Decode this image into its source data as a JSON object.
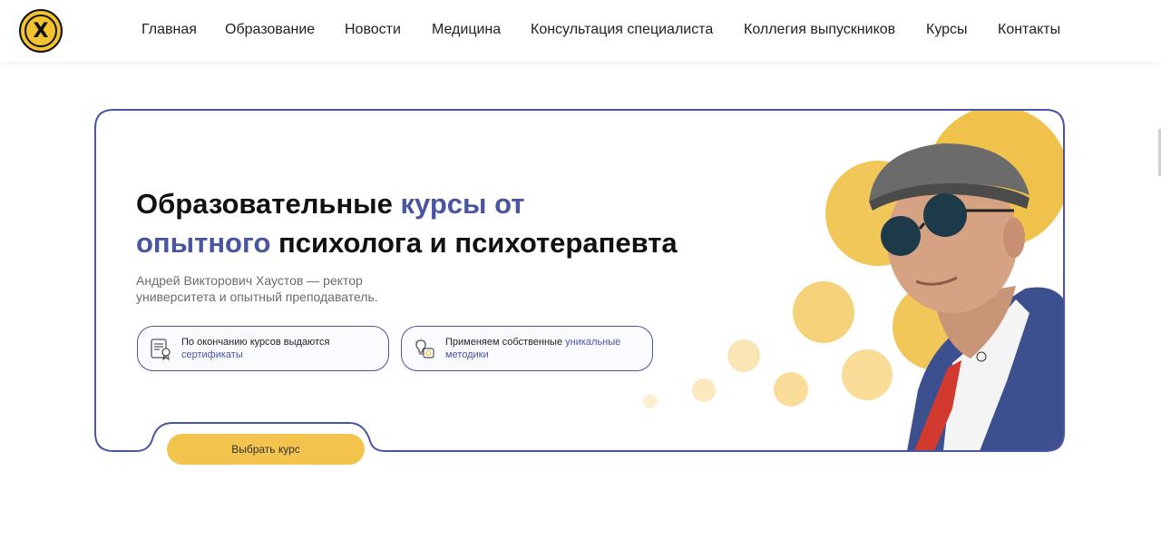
{
  "brand": {
    "logo_letter": "X"
  },
  "nav": {
    "items": [
      {
        "label": "Главная"
      },
      {
        "label": "Образование"
      },
      {
        "label": "Новости"
      },
      {
        "label": "Медицина"
      },
      {
        "label": "Консультация специалиста"
      },
      {
        "label": "Коллегия выпускников"
      },
      {
        "label": "Курсы"
      },
      {
        "label": "Контакты"
      }
    ]
  },
  "hero": {
    "title_part1": "Образовательные ",
    "title_accent1": "курсы от",
    "title_accent2": "опытного",
    "title_part2": " психолога и психотерапевта",
    "subtitle": "Андрей Викторович Хаустов — ректор университета и опытный преподаватель.",
    "features": [
      {
        "text": "По окончанию курсов выдаются ",
        "accent": "сертификаты",
        "icon": "certificate-icon"
      },
      {
        "text": "Применяем собственные ",
        "accent": "уникальные методики",
        "icon": "lightbulb-gear-icon"
      }
    ],
    "cta_label": "Выбрать курс"
  },
  "colors": {
    "accent": "#4a55a2",
    "yellow": "#f2c44e",
    "text": "#111111"
  }
}
